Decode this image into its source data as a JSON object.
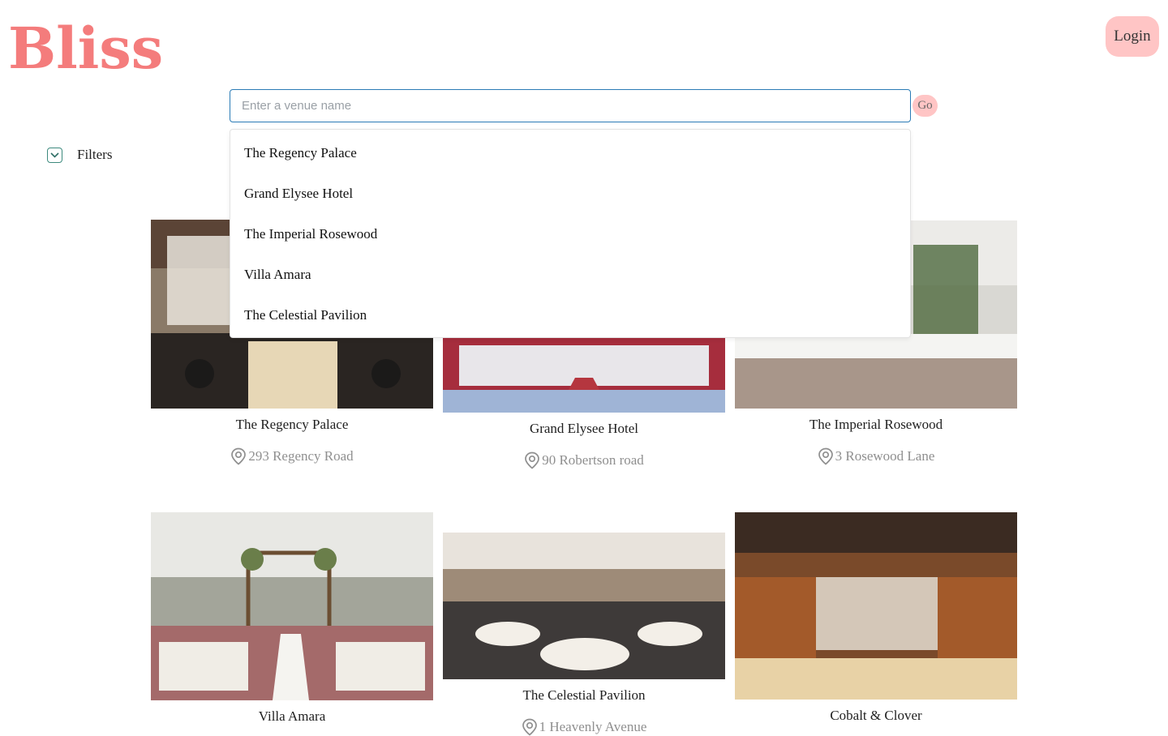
{
  "brand": {
    "logo": "Bliss",
    "accent": "#f47c7c",
    "button_bg": "#ffc5c5"
  },
  "header": {
    "login_label": "Login"
  },
  "search": {
    "placeholder": "Enter a venue name",
    "value": "",
    "go_label": "Go"
  },
  "filters": {
    "label": "Filters",
    "icon": "chevron-down-icon"
  },
  "suggestions": [
    "The Regency Palace",
    "Grand Elysee Hotel",
    "The Imperial Rosewood",
    "Villa Amara",
    "The Celestial Pavilion"
  ],
  "venues": [
    {
      "name": "The Regency Palace",
      "address": "293 Regency Road"
    },
    {
      "name": "Grand Elysee Hotel",
      "address": "90 Robertson road"
    },
    {
      "name": "The Imperial Rosewood",
      "address": "3 Rosewood Lane"
    },
    {
      "name": "Villa Amara",
      "address": ""
    },
    {
      "name": "The Celestial Pavilion",
      "address": "1 Heavenly Avenue"
    },
    {
      "name": "Cobalt & Clover",
      "address": ""
    }
  ]
}
